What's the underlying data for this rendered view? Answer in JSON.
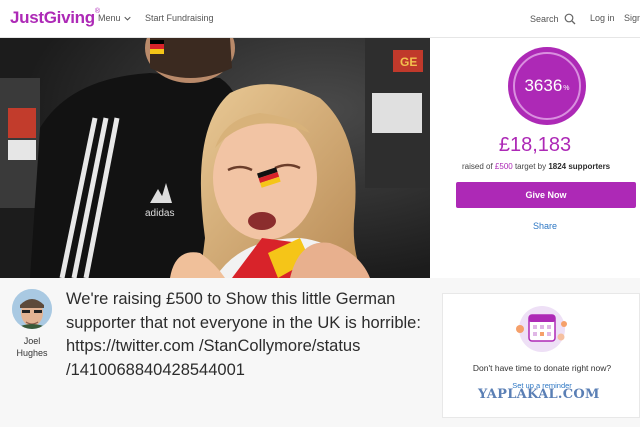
{
  "header": {
    "logo": "JustGiving",
    "logo_tm": "®",
    "menu_label": "Menu",
    "start_label": "Start Fundraising",
    "search_label": "Search",
    "login_label": "Log in",
    "signup_label": "Sign up"
  },
  "hero": {
    "jersey_text": "GE"
  },
  "campaign": {
    "percent_value": "3636",
    "percent_unit": "%",
    "percent_fraction": 36.36,
    "amount_raised": "£18,183",
    "raised_prefix": "raised of",
    "target": "£500",
    "target_suffix": "target by",
    "supporters": "1824 supporters",
    "give_label": "Give Now",
    "share_label": "Share"
  },
  "story": {
    "author_first": "Joel",
    "author_last": "Hughes",
    "text": "We're raising £500 to Show this little German supporter that not everyone in the UK is horrible: https://twitter.com /StanCollymore/status /1410068840428544001"
  },
  "reminder": {
    "question": "Don't have time to donate right now?",
    "link_label": "Set up a reminder"
  },
  "watermark": "YAPLAKAL.COM",
  "colors": {
    "brand": "#ad29b6",
    "link": "#2d77c4"
  }
}
